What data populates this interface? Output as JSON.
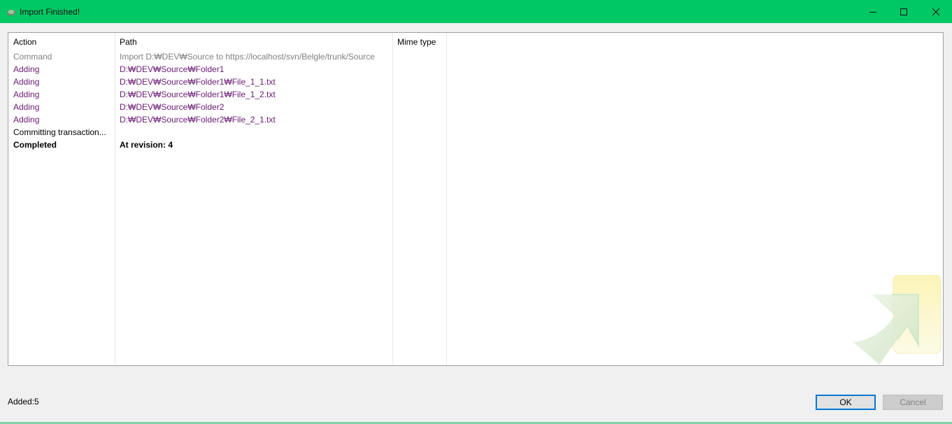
{
  "window": {
    "title": "Import Finished!",
    "accent_color": "#00c864"
  },
  "list": {
    "headers": {
      "action": "Action",
      "path": "Path",
      "mime": "Mime type"
    },
    "rows": [
      {
        "action": "Command",
        "path": "Import D:₩DEV₩Source to https://localhost/svn/Belgle/trunk/Source",
        "style": "gray"
      },
      {
        "action": "Adding",
        "path": "D:₩DEV₩Source₩Folder1",
        "style": "purple"
      },
      {
        "action": "Adding",
        "path": "D:₩DEV₩Source₩Folder1₩File_1_1.txt",
        "style": "purple"
      },
      {
        "action": "Adding",
        "path": "D:₩DEV₩Source₩Folder1₩File_1_2.txt",
        "style": "purple"
      },
      {
        "action": "Adding",
        "path": "D:₩DEV₩Source₩Folder2",
        "style": "purple"
      },
      {
        "action": "Adding",
        "path": "D:₩DEV₩Source₩Folder2₩File_2_1.txt",
        "style": "purple"
      },
      {
        "action": "Committing transaction...",
        "path": "",
        "style": "black"
      },
      {
        "action": "Completed",
        "path": "At revision: 4",
        "style": "bold"
      }
    ]
  },
  "status": {
    "added": "Added:5"
  },
  "buttons": {
    "ok": "OK",
    "cancel": "Cancel"
  }
}
